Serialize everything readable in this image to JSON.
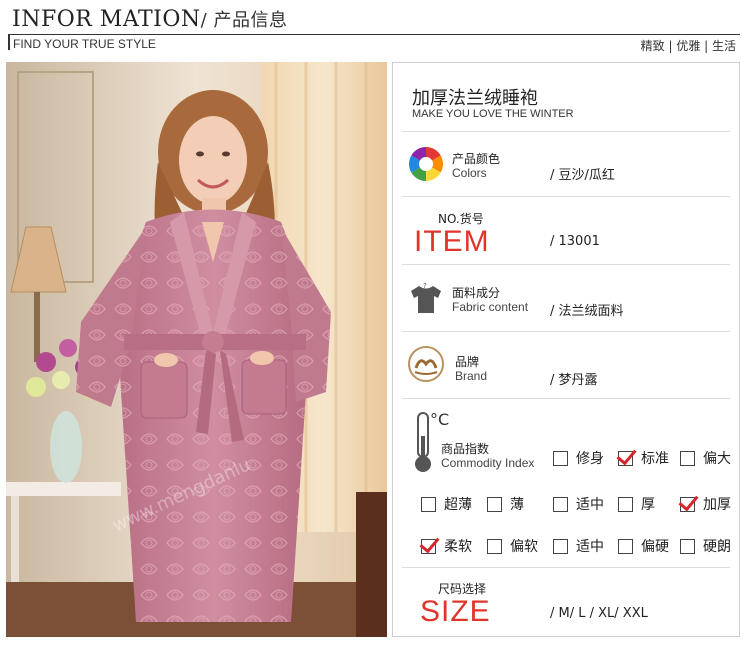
{
  "header": {
    "title_en": "INFOR MATION",
    "title_cn": "/ 产品信息",
    "subtitle": "FIND YOUR TRUE STYLE",
    "tags": "精致 | 优雅 | 生活"
  },
  "product": {
    "name": "加厚法兰绒睡袍",
    "tagline": "MAKE YOU LOVE THE WINTER"
  },
  "colors": {
    "label_cn": "产品颜色",
    "label_en": "Colors",
    "value": "/ 豆沙/瓜红",
    "icon": "color-wheel-icon"
  },
  "item": {
    "label_cn": "NO.货号",
    "big": "ITEM",
    "value": "/ 13001"
  },
  "fabric": {
    "label_cn": "面料成分",
    "label_en": "Fabric content",
    "value": "/ 法兰绒面料",
    "icon": "shirt-icon"
  },
  "brand": {
    "label_cn": "品牌",
    "label_en": "Brand",
    "value": "/ 梦丹露",
    "icon": "brand-logo-icon"
  },
  "index": {
    "label_cn": "商品指数",
    "label_en": "Commodity Index",
    "icon": "thermometer-icon",
    "thermo_unit": "°C",
    "rows": [
      [
        {
          "label": "修身",
          "checked": false
        },
        {
          "label": "标准",
          "checked": true
        },
        {
          "label": "偏大",
          "checked": false
        }
      ],
      [
        {
          "label": "超薄",
          "checked": false
        },
        {
          "label": "薄",
          "checked": false
        },
        {
          "label": "适中",
          "checked": false
        },
        {
          "label": "厚",
          "checked": false
        },
        {
          "label": "加厚",
          "checked": true
        }
      ],
      [
        {
          "label": "柔软",
          "checked": true
        },
        {
          "label": "偏软",
          "checked": false
        },
        {
          "label": "适中",
          "checked": false
        },
        {
          "label": "偏硬",
          "checked": false
        },
        {
          "label": "硬朗",
          "checked": false
        }
      ]
    ]
  },
  "size": {
    "label_cn": "尺码选择",
    "big": "SIZE",
    "value": "/ M/ L / XL/ XXL"
  },
  "colors_accent": {
    "red": "#e0352b",
    "check": "#d6262b",
    "robe": "#c77f93"
  }
}
